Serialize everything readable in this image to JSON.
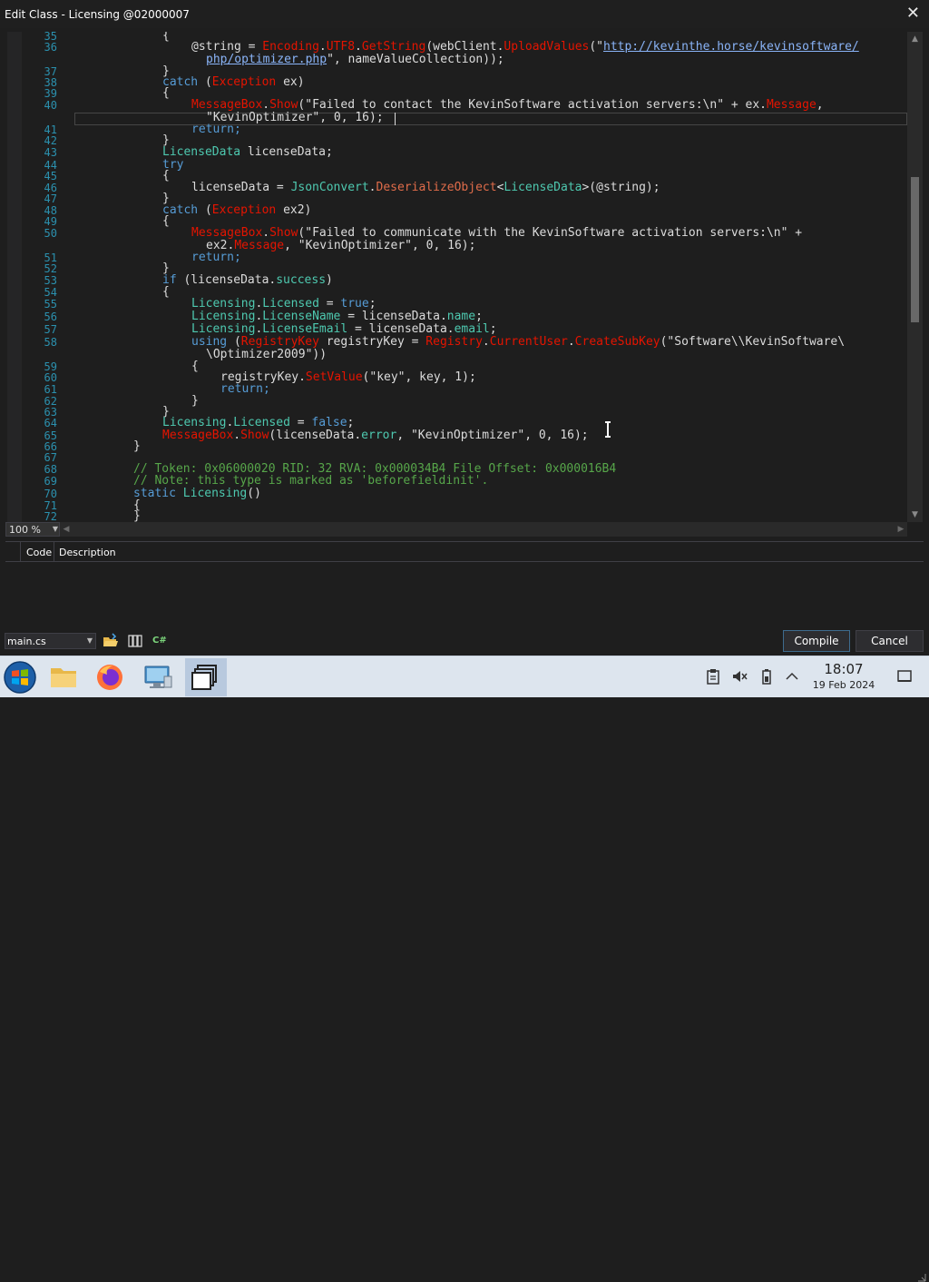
{
  "window": {
    "title": "Edit Class - Licensing @02000007",
    "close_glyph": "✕"
  },
  "editor": {
    "zoom": "100 %",
    "line_numbers": [
      "35",
      "36",
      "37",
      "38",
      "39",
      "40",
      "41",
      "42",
      "43",
      "44",
      "45",
      "46",
      "47",
      "48",
      "49",
      "50",
      "51",
      "52",
      "53",
      "54",
      "55",
      "56",
      "57",
      "58",
      "59",
      "60",
      "61",
      "62",
      "63",
      "64",
      "65",
      "66",
      "67",
      "68",
      "69",
      "70",
      "71",
      "72"
    ],
    "code": {
      "l35": "{",
      "l36_a": "@string = ",
      "l36_b": "Encoding",
      "l36_c": ".",
      "l36_d": "UTF8",
      "l36_e": ".",
      "l36_f": "GetString",
      "l36_g": "(webClient.",
      "l36_h": "UploadValues",
      "l36_i": "(\"",
      "l36_url1": "http://kevinthe.horse/kevinsoftware/",
      "l36b_url2": "php/optimizer.php",
      "l36b_tail": "\", nameValueCollection));",
      "l37": "}",
      "l38_kw": "catch",
      "l38_open": " (",
      "l38_type": "Exception",
      "l38_tail": " ex)",
      "l39": "{",
      "l40_a": "MessageBox",
      "l40_b": ".",
      "l40_c": "Show",
      "l40_d": "(\"Failed to contact the KevinSoftware activation servers:\\n\" + ex.",
      "l40_e": "Message",
      "l40_f": ",",
      "l40b": "\"KevinOptimizer\", 0, 16);",
      "l41": "return;",
      "l42": "}",
      "l43_type": "LicenseData",
      "l43_tail": " licenseData;",
      "l44": "try",
      "l45": "{",
      "l46_a": "licenseData = ",
      "l46_b": "JsonConvert",
      "l46_c": ".",
      "l46_d": "DeserializeObject",
      "l46_e": "<",
      "l46_f": "LicenseData",
      "l46_g": ">(@string);",
      "l47": "}",
      "l48_kw": "catch",
      "l48_open": " (",
      "l48_type": "Exception",
      "l48_tail": " ex2)",
      "l49": "{",
      "l50_a": "MessageBox",
      "l50_b": ".",
      "l50_c": "Show",
      "l50_d": "(\"Failed to communicate with the KevinSoftware activation servers:\\n\" +",
      "l50b_a": "ex2.",
      "l50b_b": "Message",
      "l50b_c": ", \"KevinOptimizer\", 0, 16);",
      "l51": "return;",
      "l52": "}",
      "l53_kw": "if",
      "l53_a": " (licenseData.",
      "l53_b": "success",
      "l53_c": ")",
      "l54": "{",
      "l55_a": "Licensing",
      "l55_b": ".",
      "l55_c": "Licensed",
      "l55_d": " = ",
      "l55_e": "true",
      "l55_f": ";",
      "l56_a": "Licensing",
      "l56_b": ".",
      "l56_c": "LicenseName",
      "l56_d": " = licenseData.",
      "l56_e": "name",
      "l56_f": ";",
      "l57_a": "Licensing",
      "l57_b": ".",
      "l57_c": "LicenseEmail",
      "l57_d": " = licenseData.",
      "l57_e": "email",
      "l57_f": ";",
      "l58_kw": "using",
      "l58_a": " (",
      "l58_b": "RegistryKey",
      "l58_c": " registryKey = ",
      "l58_d": "Registry",
      "l58_e": ".",
      "l58_f": "CurrentUser",
      "l58_g": ".",
      "l58_h": "CreateSubKey",
      "l58_i": "(\"Software\\\\KevinSoftware\\",
      "l58b": "\\Optimizer2009\"))",
      "l59": "{",
      "l60_a": "registryKey.",
      "l60_b": "SetValue",
      "l60_c": "(\"key\", ",
      "l60_d": "key",
      "l60_e": ", 1);",
      "l61": "return;",
      "l62": "}",
      "l63": "}",
      "l64_a": "Licensing",
      "l64_b": ".",
      "l64_c": "Licensed",
      "l64_d": " = ",
      "l64_e": "false",
      "l64_f": ";",
      "l65_a": "MessageBox",
      "l65_b": ".",
      "l65_c": "Show",
      "l65_d": "(licenseData.",
      "l65_e": "error",
      "l65_f": ", \"KevinOptimizer\", 0, 16);",
      "l66": "}",
      "l68": "// Token: 0x06000020 RID: 32 RVA: 0x000034B4 File Offset: 0x000016B4",
      "l69": "// Note: this type is marked as 'beforefieldinit'.",
      "l70_kw": "static",
      "l70_a": " ",
      "l70_b": "Licensing",
      "l70_c": "()",
      "l71": "{",
      "l72": "}"
    }
  },
  "error_panel": {
    "columns": [
      "Code",
      "Description"
    ]
  },
  "bottom": {
    "file": "main.cs",
    "compile_label": "Compile",
    "cancel_label": "Cancel",
    "csharp_icon_text": "C#"
  },
  "taskbar": {
    "time": "18:07",
    "date": "19 Feb 2024"
  },
  "colors": {
    "keyword": "#569cd6",
    "type": "#4ec9b0",
    "member": "#e51400",
    "string": "#d69d85",
    "comment": "#57a64a",
    "line_number": "#2b91af"
  }
}
